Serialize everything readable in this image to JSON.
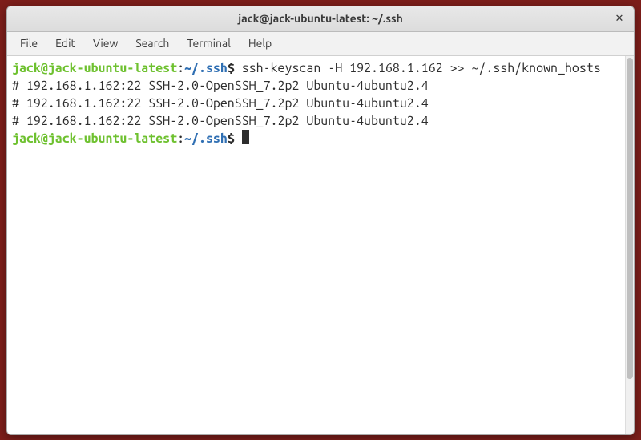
{
  "window": {
    "title": "jack@jack-ubuntu-latest: ~/.ssh",
    "close_glyph": "✕"
  },
  "menubar": {
    "items": [
      {
        "label": "File"
      },
      {
        "label": "Edit"
      },
      {
        "label": "View"
      },
      {
        "label": "Search"
      },
      {
        "label": "Terminal"
      },
      {
        "label": "Help"
      }
    ]
  },
  "terminal": {
    "prompt_user": "jack@jack-ubuntu-latest",
    "prompt_sep": ":",
    "prompt_path": "~/.ssh",
    "prompt_symbol": "$",
    "command": " ssh-keyscan -H 192.168.1.162 >> ~/.ssh/known_hosts",
    "output_lines": [
      "# 192.168.1.162:22 SSH-2.0-OpenSSH_7.2p2 Ubuntu-4ubuntu2.4",
      "# 192.168.1.162:22 SSH-2.0-OpenSSH_7.2p2 Ubuntu-4ubuntu2.4",
      "# 192.168.1.162:22 SSH-2.0-OpenSSH_7.2p2 Ubuntu-4ubuntu2.4"
    ]
  }
}
